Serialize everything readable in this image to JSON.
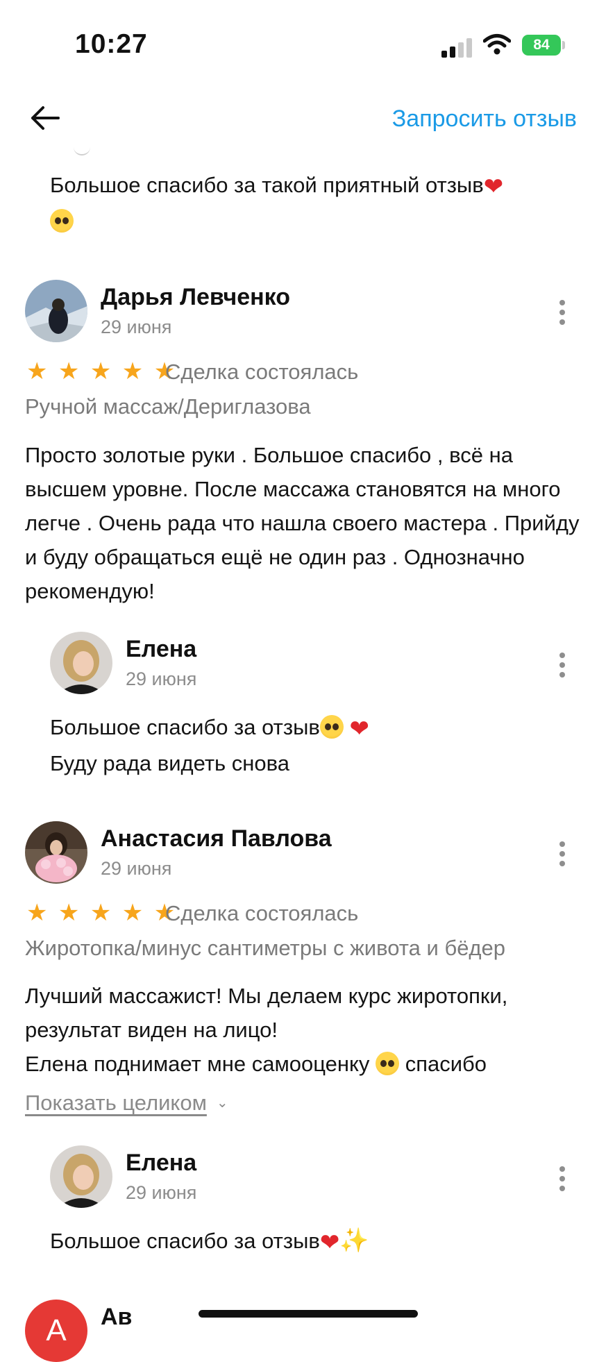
{
  "status": {
    "time": "10:27",
    "battery": "84"
  },
  "nav": {
    "action_label": "Запросить отзыв"
  },
  "top_reply": {
    "text": "Большое спасибо за такой приятный отзыв"
  },
  "reviews": [
    {
      "author": "Дарья Левченко",
      "date": "29 июня",
      "rating": 5,
      "stars": "★ ★ ★ ★ ★",
      "deal_status": "Сделка состоялась",
      "service": "Ручной массаж/Дериглазова",
      "text": "Просто золотые руки . Большое спасибо , всё на высшем уровне. После массажа становятся на много легче . Очень рада что нашла своего мастера . Прийду и буду обращаться ещё не один раз . Однозначно рекомендую!",
      "reply": {
        "author": "Елена",
        "date": "29 июня",
        "line1": "Большое спасибо за отзыв",
        "line2": "Буду рада видеть снова"
      }
    },
    {
      "author": "Анастасия Павлова",
      "date": "29 июня",
      "rating": 5,
      "stars": "★ ★ ★ ★ ★",
      "deal_status": "Сделка состоялась",
      "service": "Жиротопка/минус сантиметры с живота и бёдер",
      "text_line1": "Лучший массажист! Мы делаем курс жиротопки, результат виден на лицо!",
      "text_line2a": "Елена поднимает мне самооценку",
      "text_line2b": "спасибо",
      "show_more": "Показать целиком",
      "reply": {
        "author": "Елена",
        "date": "29 июня",
        "line1": "Большое спасибо за отзыв"
      }
    }
  ],
  "next_review": {
    "author_partial": "Ав",
    "avatar_letter": "А"
  },
  "icons": [
    "back-arrow-icon",
    "more-vertical-icon",
    "star-icon",
    "chevron-down-icon",
    "heart-emoji-icon",
    "pleading-face-emoji-icon",
    "smiling-face-emoji-icon",
    "sparkles-emoji-icon"
  ],
  "colors": {
    "link": "#1a9ae6",
    "stars": "#f7a51c",
    "battery": "#34c759",
    "next_avatar": "#e53935"
  }
}
